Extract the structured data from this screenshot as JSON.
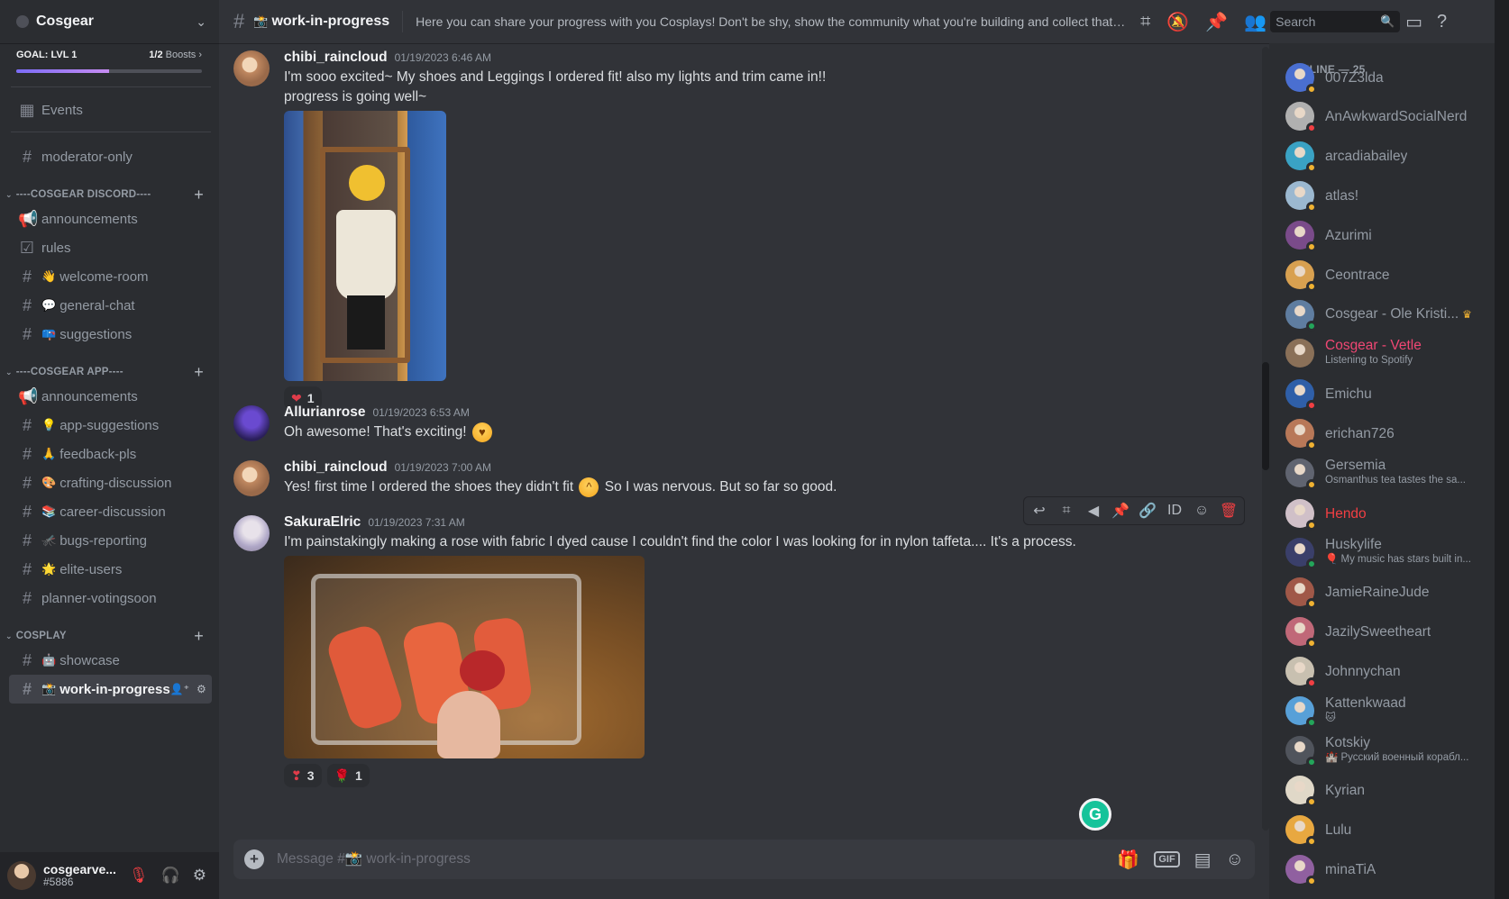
{
  "server": {
    "name": "Cosgear"
  },
  "boost": {
    "goal": "GOAL: LVL 1",
    "progress_num": "1/2",
    "progress_label": "Boosts",
    "fill_fraction": 0.5
  },
  "sidebar": {
    "events_label": "Events",
    "moderator_channel": "moderator-only",
    "categories": [
      {
        "name": "----COSGEAR DISCORD----"
      },
      {
        "name": "----COSGEAR APP----"
      },
      {
        "name": "COSPLAY"
      }
    ],
    "channels": {
      "announcements1": "announcements",
      "rules": "rules",
      "welcome": "welcome-room",
      "general": "general-chat",
      "suggestions": "suggestions",
      "announcements2": "announcements",
      "app_suggestions": "app-suggestions",
      "feedback": "feedback-pls",
      "crafting": "crafting-discussion",
      "career": "career-discussion",
      "bugs": "bugs-reporting",
      "elite": "elite-users",
      "planner": "planner-votingsoon",
      "showcase": "showcase",
      "wip": "work-in-progress"
    }
  },
  "user": {
    "name": "cosgearve...",
    "tag": "#5886"
  },
  "channel": {
    "name": "work-in-progress",
    "topic": "Here you can share your progress with you Cosplays! Don't be shy, show the community what you're building and collect that well ..."
  },
  "search": {
    "placeholder": "Search"
  },
  "messages": [
    {
      "author": "chibi_raincloud",
      "time": "01/19/2023 6:46 AM",
      "lines": [
        "I'm sooo excited~ My shoes and Leggings I ordered fit! also my lights and trim came in!!",
        "progress is going well~"
      ],
      "reactions": [
        {
          "emoji": "❤",
          "count": "1"
        }
      ]
    },
    {
      "author": "Allurianrose",
      "time": "01/19/2023 6:53 AM",
      "text": "Oh awesome!  That's exciting!"
    },
    {
      "author": "chibi_raincloud",
      "time": "01/19/2023 7:00 AM",
      "text_before": "Yes! first time I ordered the shoes they didn't fit",
      "text_after": "So I was nervous. But so far so good."
    },
    {
      "author": "SakuraElric",
      "time": "01/19/2023 7:31 AM",
      "text": "I'm painstakingly making a rose with fabric I dyed cause I couldn't find the color I was looking for in nylon taffeta.... It's a process.",
      "reactions": [
        {
          "emoji": "❣",
          "count": "3"
        },
        {
          "emoji": "🌹",
          "count": "1"
        }
      ]
    }
  ],
  "composer": {
    "placeholder": "Message #📸 work-in-progress"
  },
  "members": {
    "header": "ONLINE — 25",
    "list": [
      {
        "name": "007Z3lda",
        "status": "idle",
        "color": "#4a6fd1"
      },
      {
        "name": "AnAwkwardSocialNerd",
        "status": "dnd",
        "color": "#b0b0b0"
      },
      {
        "name": "arcadiabailey",
        "status": "idle",
        "color": "#3aa2c4"
      },
      {
        "name": "atlas!",
        "status": "idle",
        "color": "#9bb8d0"
      },
      {
        "name": "Azurimi",
        "status": "idle",
        "color": "#7a4b8a"
      },
      {
        "name": "Ceontrace",
        "status": "idle",
        "color": "#d8a050"
      },
      {
        "name": "Cosgear - Ole Kristi...",
        "status": "online",
        "color": "#5f7da0",
        "crown": true
      },
      {
        "name": "Cosgear - Vetle",
        "status": "none",
        "color": "#8a7058",
        "activity": "Listening to Spotify",
        "name_color": "pink"
      },
      {
        "name": "Emichu",
        "status": "dnd",
        "color": "#2f5fa8"
      },
      {
        "name": "erichan726",
        "status": "idle",
        "color": "#b87858"
      },
      {
        "name": "Gersemia",
        "status": "idle",
        "color": "#606470",
        "activity": "Osmanthus tea tastes the sa..."
      },
      {
        "name": "Hendo",
        "status": "idle",
        "color": "#d0c0c8",
        "name_color": "red"
      },
      {
        "name": "Huskylife",
        "status": "online",
        "color": "#3a3f6a",
        "activity": "🎈 My music has stars built in..."
      },
      {
        "name": "JamieRaineJude",
        "status": "idle",
        "color": "#a05848"
      },
      {
        "name": "JazilySweetheart",
        "status": "idle",
        "color": "#c06878"
      },
      {
        "name": "Johnnychan",
        "status": "dnd",
        "color": "#c8c0b0"
      },
      {
        "name": "Kattenkwaad",
        "status": "online",
        "color": "#58a0d8",
        "activity": "🐱"
      },
      {
        "name": "Kotskiy",
        "status": "online",
        "color": "#50545c",
        "activity": "🏰 Русский военный корабл..."
      },
      {
        "name": "Kyrian",
        "status": "idle",
        "color": "#e0d8c8"
      },
      {
        "name": "Lulu",
        "status": "idle",
        "color": "#e8a840"
      },
      {
        "name": "minaTiA",
        "status": "idle",
        "color": "#9060a0"
      }
    ]
  }
}
